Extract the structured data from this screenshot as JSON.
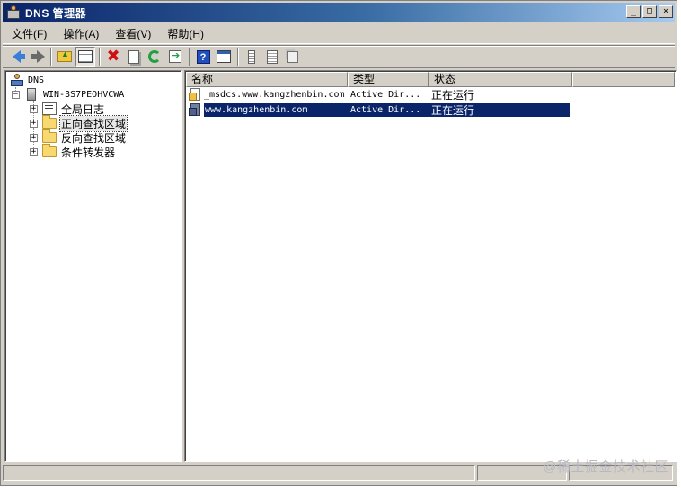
{
  "window": {
    "title": "DNS 管理器",
    "controls": {
      "minimize": "_",
      "maximize": "□",
      "close": "×"
    }
  },
  "menu": {
    "items": [
      "文件(F)",
      "操作(A)",
      "查看(V)",
      "帮助(H)"
    ]
  },
  "toolbar": {
    "buttons": [
      "back-icon",
      "forward-icon",
      "up-one-level-icon",
      "show-hide-tree-icon",
      "delete-icon",
      "properties-doc-icon",
      "refresh-icon",
      "export-list-icon",
      "help-icon",
      "show-hide-action-pane-icon",
      "column-icon",
      "list-icon",
      "copy-icon"
    ]
  },
  "tree": {
    "root": "DNS",
    "server": "WIN-3S7PEOHVCWA",
    "nodes": [
      "全局日志",
      "正向查找区域",
      "反向查找区域",
      "条件转发器"
    ],
    "selected": "正向查找区域"
  },
  "list": {
    "columns": [
      "名称",
      "类型",
      "状态"
    ],
    "rows": [
      {
        "name": "_msdcs.www.kangzhenbin.com",
        "type": "Active Dir...",
        "status": "正在运行",
        "selected": false
      },
      {
        "name": "www.kangzhenbin.com",
        "type": "Active Dir...",
        "status": "正在运行",
        "selected": true
      }
    ]
  },
  "watermark": "@稀土掘金技术社区",
  "colors": {
    "title_gradient_start": "#0a246a",
    "selection": "#0a246a",
    "chrome": "#d4d0c8"
  }
}
